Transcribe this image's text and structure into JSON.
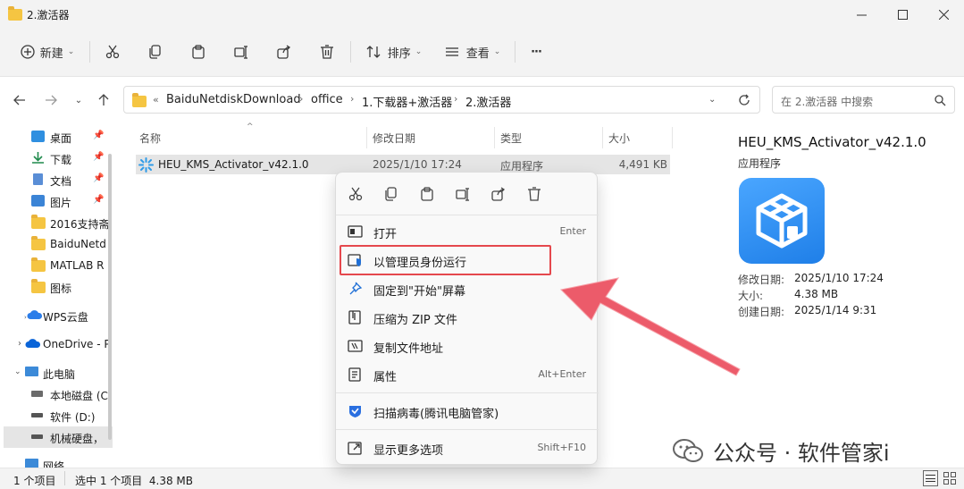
{
  "window": {
    "title": "2.激活器"
  },
  "toolbar": {
    "new_label": "新建",
    "sort_label": "排序",
    "view_label": "查看",
    "more_label": "···"
  },
  "address": {
    "overflow": "«",
    "crumbs": [
      "BaiduNetdiskDownload",
      "office",
      "1.下载器+激活器",
      "2.激活器"
    ],
    "search_placeholder": "在 2.激活器 中搜索"
  },
  "sidebar": {
    "items": [
      {
        "label": "桌面",
        "icon": "desktop-icon",
        "pinned": true
      },
      {
        "label": "下载",
        "icon": "download-icon",
        "pinned": true
      },
      {
        "label": "文档",
        "icon": "document-icon",
        "pinned": true
      },
      {
        "label": "图片",
        "icon": "picture-icon",
        "pinned": true
      },
      {
        "label": "2016支持斋",
        "icon": "folder-icon"
      },
      {
        "label": "BaiduNetd",
        "icon": "folder-icon"
      },
      {
        "label": "MATLAB R",
        "icon": "folder-icon"
      },
      {
        "label": "图标",
        "icon": "folder-icon"
      },
      {
        "label": "WPS云盘",
        "icon": "cloud-icon"
      },
      {
        "label": "OneDrive - P",
        "icon": "onedrive-icon"
      },
      {
        "label": "此电脑",
        "icon": "computer-icon"
      },
      {
        "label": "本地磁盘 (C",
        "icon": "drive-icon"
      },
      {
        "label": "软件 (D:)",
        "icon": "drive-icon"
      },
      {
        "label": "机械硬盘，",
        "icon": "drive-icon"
      },
      {
        "label": "网络",
        "icon": "network-icon"
      }
    ],
    "pin_glyph": "📌"
  },
  "columns": {
    "name": "名称",
    "date": "修改日期",
    "type": "类型",
    "size": "大小"
  },
  "files": [
    {
      "name": "HEU_KMS_Activator_v42.1.0",
      "date": "2025/1/10 17:24",
      "type": "应用程序",
      "size": "4,491 KB"
    }
  ],
  "details": {
    "title": "HEU_KMS_Activator_v42.1.0",
    "type": "应用程序",
    "rows": [
      {
        "key": "修改日期:",
        "value": "2025/1/10 17:24"
      },
      {
        "key": "大小:",
        "value": "4.38 MB"
      },
      {
        "key": "创建日期:",
        "value": "2025/1/14 9:31"
      }
    ]
  },
  "status": {
    "count": "1 个项目",
    "selected": "选中 1 个项目  4.38 MB"
  },
  "context_menu": {
    "items": [
      {
        "label": "打开",
        "shortcut": "Enter",
        "icon": "open-icon"
      },
      {
        "label": "以管理员身份运行",
        "shortcut": "",
        "icon": "shield-icon"
      },
      {
        "label": "固定到\"开始\"屏幕",
        "shortcut": "",
        "icon": "pin-icon"
      },
      {
        "label": "压缩为 ZIP 文件",
        "shortcut": "",
        "icon": "zip-icon"
      },
      {
        "label": "复制文件地址",
        "shortcut": "",
        "icon": "copy-path-icon"
      },
      {
        "label": "属性",
        "shortcut": "Alt+Enter",
        "icon": "properties-icon"
      },
      {
        "label": "扫描病毒(腾讯电脑管家)",
        "shortcut": "",
        "icon": "antivirus-icon"
      },
      {
        "label": "显示更多选项",
        "shortcut": "Shift+F10",
        "icon": "more-options-icon"
      }
    ]
  },
  "watermark": {
    "text": "公众号 · 软件管家i"
  },
  "colors": {
    "highlight": "#e5484d",
    "arrow": "#ec5b6a",
    "accent": "#1f7fe8",
    "selection": "#e5e5e5"
  }
}
